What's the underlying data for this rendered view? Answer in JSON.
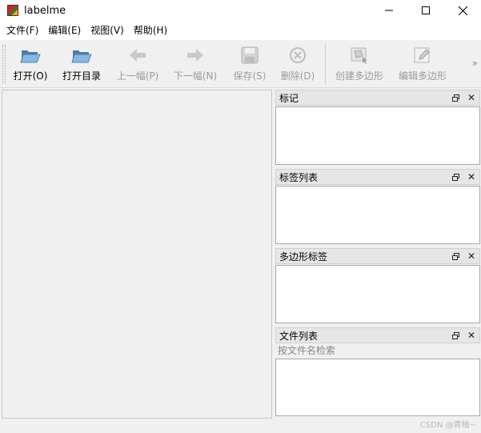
{
  "window": {
    "title": "labelme",
    "controls": [
      "minimize",
      "maximize",
      "close"
    ]
  },
  "menu": [
    {
      "label": "文件(F)"
    },
    {
      "label": "编辑(E)"
    },
    {
      "label": "视图(V)"
    },
    {
      "label": "帮助(H)"
    }
  ],
  "toolbar": {
    "open": {
      "label": "打开(O)",
      "enabled": true
    },
    "open_dir": {
      "label": "打开目录",
      "enabled": true
    },
    "prev": {
      "label": "上一幅(P)",
      "enabled": false
    },
    "next": {
      "label": "下一幅(N)",
      "enabled": false
    },
    "save": {
      "label": "保存(S)",
      "enabled": false
    },
    "delete": {
      "label": "删除(D)",
      "enabled": false
    },
    "create_polygon": {
      "label": "创建多边形",
      "enabled": false
    },
    "edit_polygon": {
      "label": "编辑多边形",
      "enabled": false
    },
    "more": "»"
  },
  "docks": {
    "flags": {
      "title": "标记"
    },
    "labels": {
      "title": "标签列表"
    },
    "polygons": {
      "title": "多边形标签"
    },
    "files": {
      "title": "文件列表",
      "search_placeholder": "按文件名检索"
    }
  },
  "watermark": "CSDN @青柚~"
}
